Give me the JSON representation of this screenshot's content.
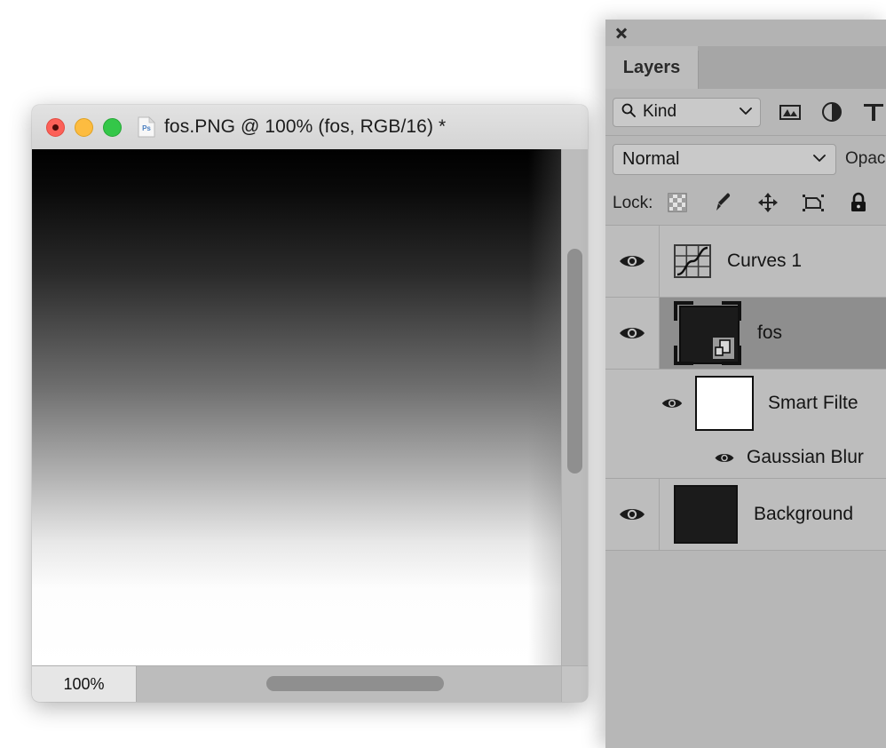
{
  "document_window": {
    "title": "fos.PNG @ 100% (fos, RGB/16) *",
    "app_icon": "photoshop-document-icon",
    "traffic_lights": {
      "close": "close-button",
      "minimize": "minimize-button",
      "zoom": "maximize-button"
    },
    "status": {
      "zoom_level": "100%"
    },
    "canvas": {
      "description": "vertical black-to-white gradient with soft light bloom near bottom center"
    }
  },
  "panel": {
    "close_label": "×",
    "tabs": [
      {
        "label": "Layers",
        "active": true
      }
    ],
    "filter": {
      "search_icon": "search-icon",
      "kind_label": "Kind",
      "chevron": "chevron-down-icon",
      "icons": [
        {
          "name": "filter-pixel-layers-icon"
        },
        {
          "name": "filter-adjustment-layers-icon"
        },
        {
          "name": "filter-type-layers-icon"
        }
      ]
    },
    "blend": {
      "mode": "Normal",
      "chevron": "chevron-down-icon",
      "opacity_label": "Opac"
    },
    "lock": {
      "label": "Lock:",
      "icons": [
        {
          "name": "lock-transparent-pixels-icon"
        },
        {
          "name": "lock-image-pixels-icon"
        },
        {
          "name": "lock-position-icon"
        },
        {
          "name": "lock-artboard-nesting-icon"
        },
        {
          "name": "lock-all-icon"
        }
      ]
    },
    "layers": [
      {
        "name": "Curves 1",
        "thumb": "curves-adjustment-icon",
        "visible": true,
        "selected": false
      },
      {
        "name": "fos",
        "thumb": "smart-object-thumbnail",
        "visible": true,
        "selected": true,
        "smart_filters": {
          "label": "Smart Filte",
          "mask_visible": true,
          "filters": [
            {
              "name": "Gaussian Blur",
              "visible": true
            }
          ]
        }
      },
      {
        "name": "Background",
        "thumb": "dark-thumbnail",
        "visible": true,
        "selected": false
      }
    ]
  },
  "colors": {
    "panel_bg": "#b7b7b7",
    "row_bg": "#bdbdbd",
    "row_selected_bg": "#8e8e8e",
    "tab_active_bg": "#bcbcbc",
    "text": "#141414",
    "close_red": "#fc6058",
    "minimize_yellow": "#fdbc40",
    "zoom_green": "#34c749"
  }
}
